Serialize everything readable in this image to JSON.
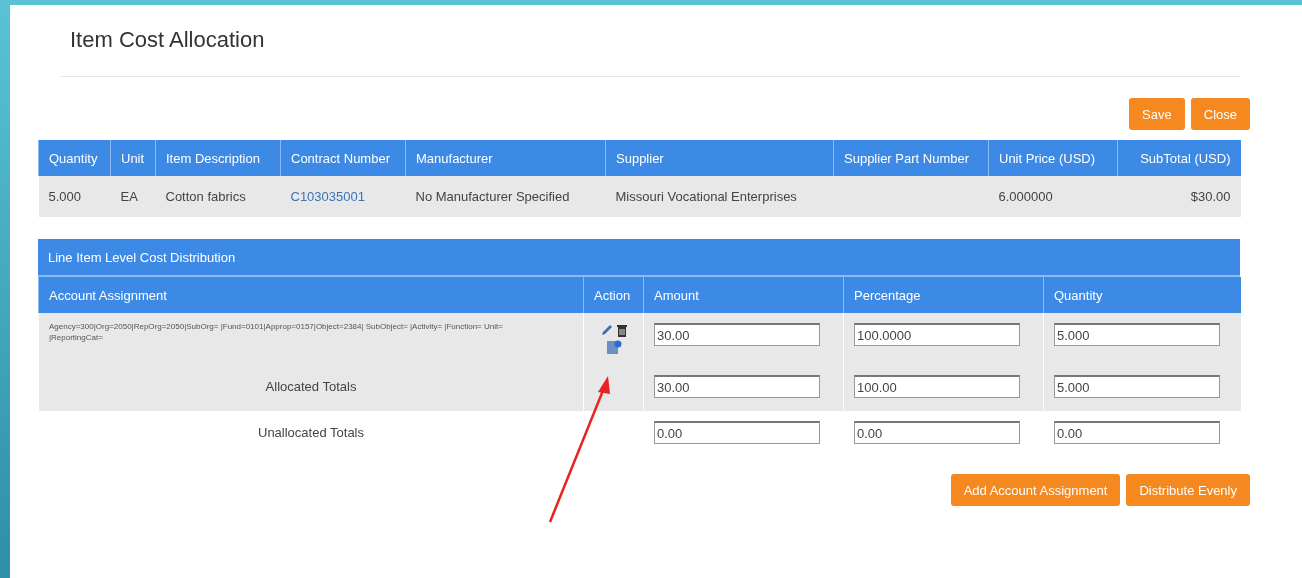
{
  "title": "Item Cost Allocation",
  "top_buttons": [
    "Save",
    "Close"
  ],
  "item_table": {
    "columns": [
      "Quantity",
      "Unit",
      "Item Description",
      "Contract Number",
      "Manufacturer",
      "Supplier",
      "Supplier Part Number",
      "Unit Price (USD)",
      "SubTotal (USD)"
    ],
    "rows": [
      [
        {
          "text": "5.000",
          "kind": "text"
        },
        {
          "text": "EA",
          "kind": "text"
        },
        {
          "text": "Cotton fabrics",
          "kind": "text"
        },
        {
          "text": "C103035001",
          "kind": "link"
        },
        {
          "text": "No Manufacturer Specified",
          "kind": "text"
        },
        {
          "text": "Missouri Vocational Enterprises",
          "kind": "text"
        },
        {
          "kind": "empty"
        },
        {
          "text": "6.000000",
          "kind": "text"
        },
        {
          "text": "$30.00",
          "kind": "money"
        }
      ]
    ]
  },
  "distribution": {
    "title": "Line Item Level Cost Distribution",
    "columns": [
      "Account Assignment",
      "Action",
      "Amount",
      "Percentage",
      "Quantity"
    ],
    "rows": [
      {
        "kind": "assignment",
        "label": "Agency=300|Org=2050|RepOrg=2050|SubOrg= |Fund=0101|Approp=0157|Object=2384| SubObject= |Activity= |Function= Unit= |ReportingCat=",
        "amount": "30.00",
        "percentage": "100.0000",
        "quantity": "5.000"
      },
      {
        "kind": "total",
        "label": "Allocated Totals",
        "amount": "30.00",
        "percentage": "100.00",
        "quantity": "5.000"
      },
      {
        "kind": "total",
        "label": "Unallocated Totals",
        "amount": "0.00",
        "percentage": "0.00",
        "quantity": "0.00"
      }
    ]
  },
  "bottom_buttons": [
    "Add Account Assignment",
    "Distribute Evenly"
  ]
}
